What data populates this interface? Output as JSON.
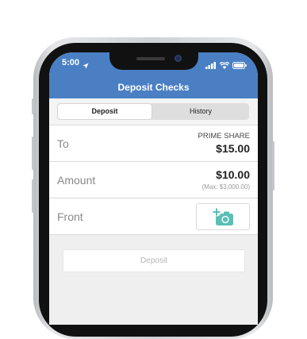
{
  "status_bar": {
    "time": "5:00"
  },
  "header": {
    "title": "Deposit Checks"
  },
  "tabs": [
    {
      "label": "Deposit",
      "active": true
    },
    {
      "label": "History",
      "active": false
    }
  ],
  "form": {
    "to": {
      "label": "To",
      "account": "PRIME SHARE",
      "balance": "$15.00"
    },
    "amount": {
      "label": "Amount",
      "value": "$10.00",
      "max": "(Max: $3,000.00)"
    },
    "front": {
      "label": "Front",
      "icon": "add-photo-icon"
    }
  },
  "deposit_button": {
    "label": "Deposit",
    "enabled": false
  },
  "colors": {
    "header": "#4a7fc4",
    "camera_icon": "#5bbfb5",
    "background": "#efeff0"
  }
}
